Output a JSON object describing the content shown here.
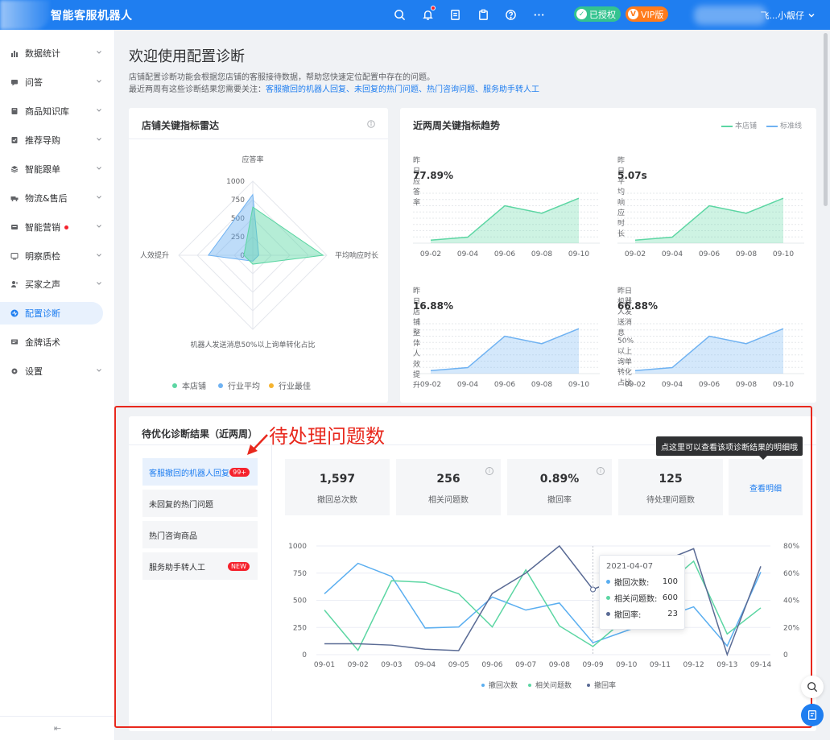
{
  "app": {
    "title": "智能客服机器人",
    "auth_badge": "已授权",
    "vip_badge": "VIP版",
    "user_label": "飞...小靓仔",
    "top_icons": [
      "search-icon",
      "bell-icon",
      "document-icon",
      "clipboard-icon",
      "help-icon",
      "more-icon"
    ]
  },
  "sidebar": {
    "items": [
      {
        "label": "数据统计",
        "icon": "bar-chart-icon",
        "chevron": true
      },
      {
        "label": "问答",
        "icon": "chat-icon",
        "chevron": true
      },
      {
        "label": "商品知识库",
        "icon": "book-icon",
        "chevron": true
      },
      {
        "label": "推荐导购",
        "icon": "tag-icon",
        "chevron": true
      },
      {
        "label": "智能跟单",
        "icon": "layers-icon",
        "chevron": true
      },
      {
        "label": "物流&售后",
        "icon": "truck-icon",
        "chevron": true
      },
      {
        "label": "智能营销",
        "icon": "mail-icon",
        "chevron": true,
        "dot": true
      },
      {
        "label": "明察质检",
        "icon": "monitor-icon",
        "chevron": true
      },
      {
        "label": "买家之声",
        "icon": "user-voice-icon",
        "chevron": true
      },
      {
        "label": "配置诊断",
        "icon": "diagnose-icon",
        "chevron": false,
        "active": true
      },
      {
        "label": "金牌话术",
        "icon": "message-icon",
        "chevron": false
      },
      {
        "label": "设置",
        "icon": "gear-icon",
        "chevron": true
      }
    ],
    "collapse_icon": "⇤"
  },
  "header": {
    "title": "欢迎使用配置诊断",
    "desc1": "店铺配置诊断功能会根据您店铺的客服接待数据，帮助您快速定位配置中存在的问题。",
    "desc2_prefix": "最近两周有这些诊断结果您需要关注：",
    "desc2_links": "客服撤回的机器人回复、未回复的热门问题、热门咨询问题、服务助手转人工"
  },
  "radar": {
    "title": "店铺关键指标雷达",
    "axes": [
      "应答率",
      "平均响应时长",
      "机器人发送消息50%以上询单转化占比",
      "人效提升"
    ],
    "ticks": [
      "1000",
      "750",
      "500",
      "250",
      "0"
    ],
    "legend": [
      "本店铺",
      "行业平均",
      "行业最佳"
    ],
    "colors": {
      "store": "#5cd6a3",
      "avg": "#6fb2f2",
      "best": "#f5b32f"
    }
  },
  "trend": {
    "title": "近两周关键指标趋势",
    "legend": [
      "本店铺",
      "标准线"
    ],
    "charts": [
      {
        "label": "昨日应答率",
        "value": "77.89%",
        "color": "green"
      },
      {
        "label": "昨日平均响应时长",
        "value": "5.07s",
        "color": "green"
      },
      {
        "label": "昨日店铺整体人效提升",
        "value": "16.88%",
        "color": "blue"
      },
      {
        "label": "昨日机器人发送消息50%以上询单转化占比",
        "value": "66.88%",
        "color": "blue"
      }
    ],
    "x_labels": [
      "09-02",
      "09-04",
      "09-06",
      "09-08",
      "09-10"
    ]
  },
  "diag": {
    "title": "待优化诊断结果（近两周）",
    "annotation": "待处理问题数",
    "tip": "点这里可以查看该项诊断结果的明细哦",
    "tabs": [
      {
        "label": "客服撤回的机器人回复",
        "badge": "99+",
        "active": true
      },
      {
        "label": "未回复的热门问题"
      },
      {
        "label": "热门咨询商品"
      },
      {
        "label": "服务助手转人工",
        "badge": "NEW"
      }
    ],
    "stats": [
      {
        "num": "1,597",
        "label": "撤回总次数",
        "info": false
      },
      {
        "num": "256",
        "label": "相关问题数",
        "info": true
      },
      {
        "num": "0.89%",
        "label": "撤回率",
        "info": true
      },
      {
        "num": "125",
        "label": "待处理问题数",
        "info": false
      }
    ],
    "detail_link": "查看明细",
    "tooltip": {
      "date": "2021-04-07",
      "rows": [
        {
          "label": "撤回次数:",
          "value": "100"
        },
        {
          "label": "相关问题数:",
          "value": "600"
        },
        {
          "label": "撤回率:",
          "value": "23"
        }
      ]
    }
  },
  "chart_data": [
    {
      "type": "line",
      "title": "",
      "categories": [
        "09-01",
        "09-02",
        "09-03",
        "09-04",
        "09-05",
        "09-06",
        "09-07",
        "09-08",
        "09-09",
        "09-10",
        "09-11",
        "09-12",
        "09-13",
        "09-14"
      ],
      "ylim_left": [
        0,
        1000
      ],
      "ylim_right": [
        0,
        80
      ],
      "left_ticks": [
        "0",
        "250",
        "500",
        "750",
        "1000"
      ],
      "right_ticks": [
        "0",
        "20%",
        "40%",
        "60%",
        "80%"
      ],
      "series": [
        {
          "name": "撤回次数",
          "axis": "left",
          "color": "#5aaef0",
          "values": [
            560,
            840,
            720,
            245,
            255,
            530,
            410,
            475,
            110,
            null,
            null,
            440,
            80,
            760
          ]
        },
        {
          "name": "相关问题数",
          "axis": "left",
          "color": "#5cd6a3",
          "values": [
            410,
            40,
            680,
            665,
            560,
            255,
            780,
            265,
            75,
            null,
            null,
            860,
            190,
            430
          ]
        },
        {
          "name": "撤回率",
          "axis": "right",
          "color": "#5a6b95",
          "values": [
            8,
            8,
            7,
            4,
            3,
            45,
            60,
            80,
            48,
            null,
            null,
            78,
            0,
            65
          ]
        }
      ],
      "legend": [
        "撤回次数",
        "相关问题数",
        "撤回率"
      ]
    }
  ]
}
